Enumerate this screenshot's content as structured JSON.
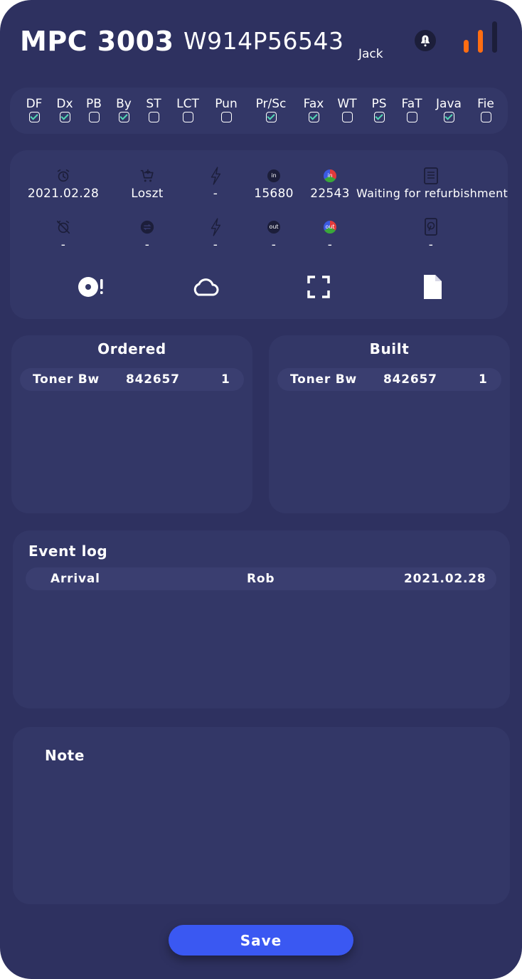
{
  "header": {
    "model": "MPC 3003",
    "serial": "W914P56543",
    "user": "Jack",
    "signal_level": 2,
    "signal_bars": 3
  },
  "options": [
    {
      "label": "DF",
      "checked": true
    },
    {
      "label": "Dx",
      "checked": true
    },
    {
      "label": "PB",
      "checked": false
    },
    {
      "label": "By",
      "checked": true
    },
    {
      "label": "ST",
      "checked": false
    },
    {
      "label": "LCT",
      "checked": false
    },
    {
      "label": "Pun",
      "checked": false
    },
    {
      "label": "Pr/Sc",
      "checked": true
    },
    {
      "label": "Fax",
      "checked": true
    },
    {
      "label": "WT",
      "checked": false
    },
    {
      "label": "PS",
      "checked": true
    },
    {
      "label": "FaT",
      "checked": false
    },
    {
      "label": "Java",
      "checked": true
    },
    {
      "label": "Fie",
      "checked": false
    }
  ],
  "info": {
    "row1": {
      "date": "2021.02.28",
      "location": "Loszt",
      "power": "-",
      "counter_in": "15680",
      "counter_color_in": "22543",
      "status": "Waiting for refurbishment",
      "in_label": "in"
    },
    "row2": {
      "date": "-",
      "transfer": "-",
      "power": "-",
      "counter_out": "-",
      "counter_color_out": "-",
      "disk": "-",
      "out_label": "out"
    }
  },
  "ordered": {
    "title": "Ordered",
    "rows": [
      {
        "name": "Toner Bw",
        "code": "842657",
        "qty": "1"
      }
    ]
  },
  "built": {
    "title": "Built",
    "rows": [
      {
        "name": "Toner Bw",
        "code": "842657",
        "qty": "1"
      }
    ]
  },
  "event_log": {
    "title": "Event log",
    "rows": [
      {
        "event": "Arrival",
        "user": "Rob",
        "date": "2021.02.28"
      }
    ]
  },
  "note": {
    "title": "Note",
    "text": ""
  },
  "save_label": "Save",
  "colors": {
    "background": "#2e3160",
    "card": "#333767",
    "accent": "#3a58f2",
    "signal_active": "#ff6d12",
    "signal_inactive": "#1c1e3a",
    "check": "#53d6b4"
  }
}
